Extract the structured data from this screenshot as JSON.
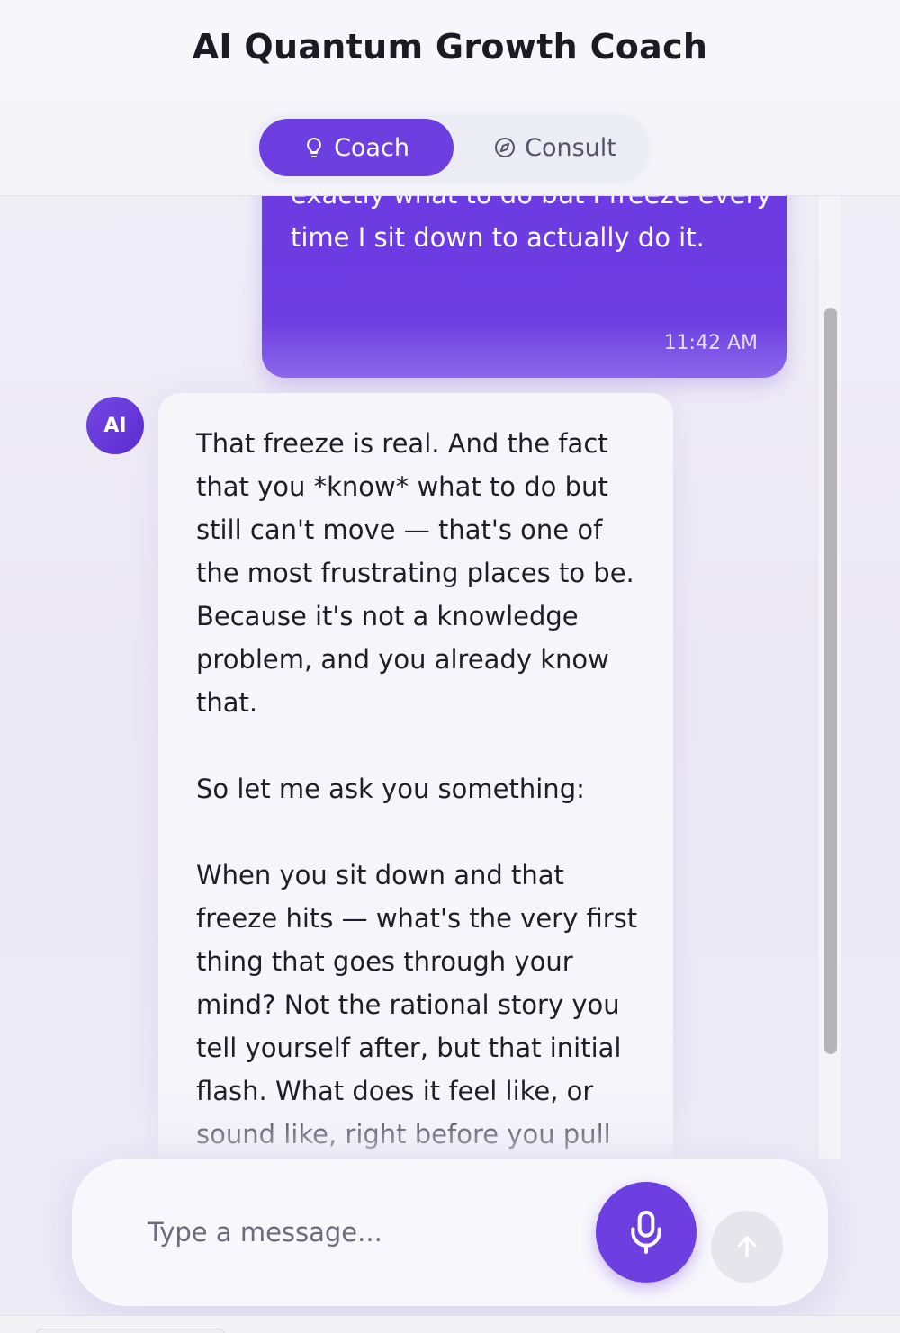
{
  "header": {
    "title": "AI Quantum Growth Coach"
  },
  "tabs": [
    {
      "label": "Coach",
      "icon": "lightbulb-icon",
      "active": true
    },
    {
      "label": "Consult",
      "icon": "compass-icon",
      "active": false
    }
  ],
  "messages": {
    "user": {
      "text": "exactly what to do but I freeze every time I sit down to actually do it.",
      "time": "11:42 AM"
    },
    "ai": {
      "avatar": "AI",
      "paragraphs": [
        "That freeze is real. And the fact that you *know* what to do but still can't move — that's one of the most frustrating places to be. Because it's not a knowledge problem, and you already know that.",
        "So let me ask you something:",
        "When you sit down and that freeze hits — what's the very first thing that goes through your mind? Not the rational story you tell yourself after, but that initial flash. What does it feel like, or sound like, right before you pull"
      ]
    }
  },
  "composer": {
    "placeholder": "Type a message...",
    "mic_icon": "microphone-icon",
    "send_icon": "arrow-up-icon"
  },
  "colors": {
    "accent": "#6d3ee0",
    "background": "#eceaf6"
  }
}
